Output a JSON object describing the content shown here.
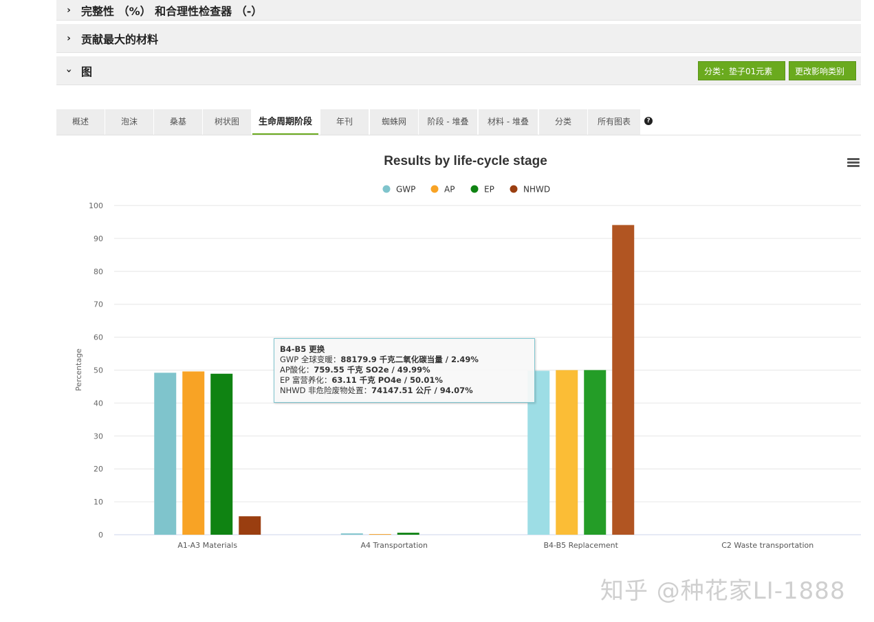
{
  "panels": {
    "completeness": "完整性 （%） 和合理性检查器 （-）",
    "materials": "贡献最大的材料",
    "figure": "图"
  },
  "buttons": {
    "classify": "分类：垫子01元素",
    "change_impact": "更改影响类别"
  },
  "tabs": [
    "概述",
    "泡沫",
    "桑基",
    "树状图",
    "生命周期阶段",
    "年刊",
    "蜘蛛网",
    "阶段 - 堆叠",
    "材料 - 堆叠",
    "分类",
    "所有图表"
  ],
  "active_tab": 4,
  "icons": {
    "help": "question-circle-icon",
    "menu": "hamburger-menu-icon"
  },
  "tooltip": {
    "title": "B4-B5 更换",
    "lines": [
      {
        "label": "GWP 全球变暖：",
        "value": "88179.9 千克二氧化碳当量 / 2.49%"
      },
      {
        "label": "AP酸化：",
        "value": "759.55 千克 SO2e / 49.99%"
      },
      {
        "label": "EP 富营养化：",
        "value": "63.11 千克 PO4e / 50.01%"
      },
      {
        "label": "NHWD 非危险废物处置：",
        "value": "74147.51 公斤 / 94.07%"
      }
    ]
  },
  "watermark": "知乎 @种花家LI-1888",
  "chart_data": {
    "type": "bar",
    "title": "Results by life-cycle stage",
    "ylabel": "Percentage",
    "xlabel": "",
    "ylim": [
      0,
      100
    ],
    "yticks": [
      0,
      10,
      20,
      30,
      40,
      50,
      60,
      70,
      80,
      90,
      100
    ],
    "grid": true,
    "legend_position": "top-center",
    "categories": [
      "A1-A3 Materials",
      "A4 Transportation",
      "B4-B5 Replacement",
      "C2 Waste transportation"
    ],
    "series": [
      {
        "name": "GWP",
        "color": "#7fc4cc",
        "values": [
          49.2,
          0.4,
          49.8,
          0
        ]
      },
      {
        "name": "AP",
        "color": "#f8a325",
        "values": [
          49.6,
          0.2,
          49.99,
          0
        ]
      },
      {
        "name": "EP",
        "color": "#0f8312",
        "values": [
          48.9,
          0.6,
          50.01,
          0
        ]
      },
      {
        "name": "NHWD",
        "color": "#9a3e10",
        "values": [
          5.6,
          0,
          94.07,
          0
        ]
      }
    ],
    "hover_category": 2,
    "hover_colors": [
      "#9ddde5",
      "#fbbd36",
      "#249d27",
      "#b15522"
    ]
  }
}
